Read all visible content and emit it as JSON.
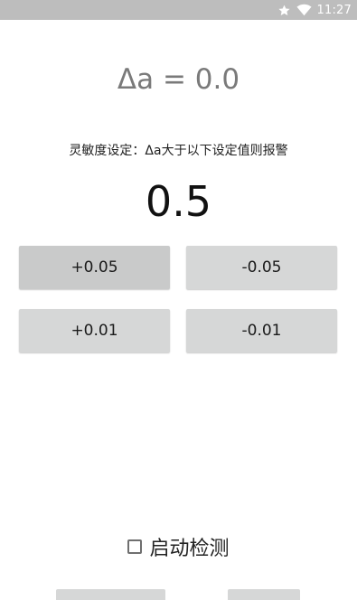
{
  "status_bar": {
    "time": "11:27",
    "icons": [
      "star-icon",
      "wifi-icon"
    ]
  },
  "readout": {
    "delta_text": "Δa = 0.0"
  },
  "sensitivity": {
    "label": "灵敏度设定：Δa大于以下设定值则报警",
    "value": "0.5"
  },
  "buttons": {
    "plus_005": "+0.05",
    "minus_005": "-0.05",
    "plus_001": "+0.01",
    "minus_001": "-0.01"
  },
  "start_detection": {
    "label": "启动检测",
    "checked": false
  },
  "colors": {
    "status_bar_bg": "#bdbdbd",
    "button_bg": "#d6d7d7",
    "button_pressed_bg": "#c9caca",
    "readout_text": "#7a7a7a"
  }
}
